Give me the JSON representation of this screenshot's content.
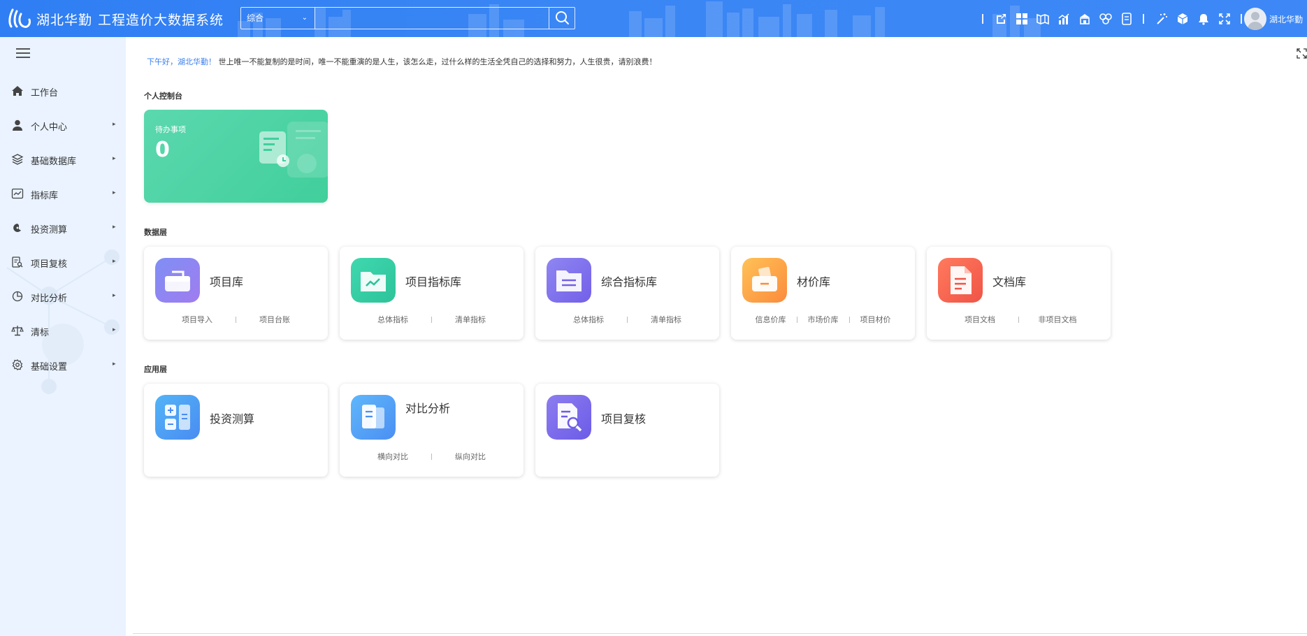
{
  "header": {
    "brand": "湖北华勤",
    "system_title": "工程造价大数据系统",
    "search_category": "综合",
    "search_placeholder": "",
    "icons": [
      "share-icon",
      "dashboard-grid-icon",
      "map-icon",
      "bar-chart-icon",
      "building-icon",
      "network-icon",
      "document-icon",
      "magic-wand-icon",
      "cube-icon",
      "bell-icon",
      "fullscreen-icon"
    ],
    "user_name": "湖北华勤"
  },
  "sidebar": {
    "items": [
      {
        "label": "工作台",
        "icon": "home-icon",
        "has_children": false
      },
      {
        "label": "个人中心",
        "icon": "user-icon",
        "has_children": true
      },
      {
        "label": "基础数据库",
        "icon": "layers-icon",
        "has_children": true
      },
      {
        "label": "指标库",
        "icon": "line-chart-icon",
        "has_children": true
      },
      {
        "label": "投资测算",
        "icon": "calculator-icon",
        "has_children": true
      },
      {
        "label": "项目复核",
        "icon": "review-icon",
        "has_children": true
      },
      {
        "label": "对比分析",
        "icon": "pie-chart-icon",
        "has_children": true
      },
      {
        "label": "清标",
        "icon": "scale-icon",
        "has_children": true
      },
      {
        "label": "基础设置",
        "icon": "gear-icon",
        "has_children": true
      }
    ]
  },
  "main": {
    "greeting_hi": "下午好，湖北华勤！",
    "greeting_text": "世上唯一不能复制的是时间，唯一不能重演的是人生，该怎么走，过什么样的生活全凭自己的选择和努力，人生很贵，请别浪费！",
    "personal_section": "个人控制台",
    "todo": {
      "label": "待办事项",
      "count": "0"
    },
    "data_section": "数据层",
    "data_cards": [
      {
        "name": "项目库",
        "links": [
          "项目导入",
          "项目台账"
        ],
        "colors": [
          "#7f8ff4",
          "#a07cf0"
        ]
      },
      {
        "name": "项目指标库",
        "links": [
          "总体指标",
          "清单指标"
        ],
        "colors": [
          "#3fd8ae",
          "#2ec39a"
        ]
      },
      {
        "name": "综合指标库",
        "links": [
          "总体指标",
          "清单指标"
        ],
        "colors": [
          "#8f86f2",
          "#7360e8"
        ]
      },
      {
        "name": "材价库",
        "links": [
          "信息价库",
          "市场价库",
          "项目材价"
        ],
        "colors": [
          "#ffc257",
          "#fb8b3c"
        ]
      },
      {
        "name": "文档库",
        "links": [
          "项目文档",
          "非项目文档"
        ],
        "colors": [
          "#ff7a5e",
          "#f05446"
        ]
      }
    ],
    "app_section": "应用层",
    "app_cards": [
      {
        "name": "投资测算",
        "links": [],
        "colors": [
          "#52b4f7",
          "#4a8cf2"
        ]
      },
      {
        "name": "对比分析",
        "links": [
          "横向对比",
          "纵向对比"
        ],
        "colors": [
          "#5fb7fb",
          "#4b8ff3"
        ]
      },
      {
        "name": "项目复核",
        "links": [],
        "colors": [
          "#8d7df0",
          "#6c5ce7"
        ]
      }
    ]
  }
}
